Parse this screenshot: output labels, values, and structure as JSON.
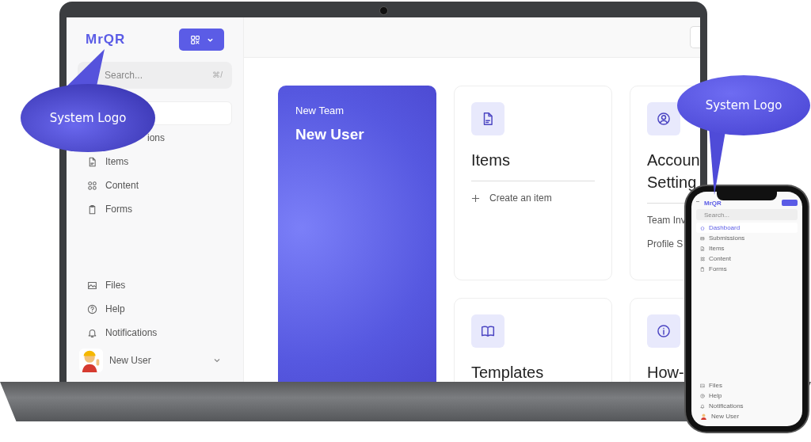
{
  "laptop": {
    "sidebar": {
      "logo": "MrQR",
      "search": {
        "placeholder": "Search...",
        "shortcut": "⌘/"
      },
      "nav": [
        {
          "selected": true,
          "kind": "covered"
        },
        {
          "label": "ions",
          "selected": false,
          "kind": "covered"
        },
        {
          "label": "Items",
          "selected": false,
          "kind": "normal"
        },
        {
          "label": "Content",
          "selected": false,
          "kind": "normal"
        },
        {
          "label": "Forms",
          "selected": false,
          "kind": "normal"
        }
      ],
      "bottom_nav": [
        {
          "label": "Files"
        },
        {
          "label": "Help"
        },
        {
          "label": "Notifications"
        }
      ],
      "user": {
        "name": "New User"
      }
    },
    "main": {
      "hero": {
        "team": "New Team",
        "user": "New User"
      },
      "cards": [
        {
          "title_lines": [
            "Items"
          ],
          "links": [
            {
              "kind": "action",
              "label": "Create an item"
            }
          ]
        },
        {
          "title_lines": [
            "Accoun",
            "Setting"
          ],
          "links": [
            {
              "kind": "link",
              "label": "Team Inv"
            },
            {
              "kind": "link",
              "label": "Profile S"
            }
          ]
        },
        {
          "title_lines": [
            "Templates"
          ]
        },
        {
          "title_lines": [
            "How-"
          ]
        }
      ]
    }
  },
  "phone": {
    "logo": "MrQR",
    "search": {
      "placeholder": "Search..."
    },
    "nav": [
      {
        "label": "Dashboard",
        "selected": true
      },
      {
        "label": "Submissions",
        "selected": false
      },
      {
        "label": "Items",
        "selected": false
      },
      {
        "label": "Content",
        "selected": false
      },
      {
        "label": "Forms",
        "selected": false
      }
    ],
    "bottom_nav": [
      {
        "label": "Files"
      },
      {
        "label": "Help"
      },
      {
        "label": "Notifications"
      }
    ],
    "user": {
      "name": "New User"
    }
  },
  "callouts": [
    {
      "text": "System Logo"
    },
    {
      "text": "System Logo"
    }
  ]
}
